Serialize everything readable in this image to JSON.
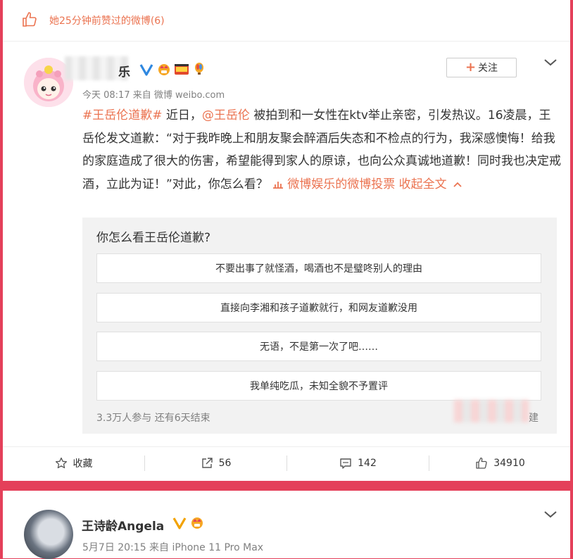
{
  "liked_bar": {
    "text": "她25分钟前赞过的微博(6)"
  },
  "post": {
    "nickname": "乐",
    "follow_label": "关注",
    "meta": "今天 08:17 来自 微博 weibo.com",
    "content": {
      "topic": "#王岳伦道歉#",
      "t1": " 近日，",
      "mention": "@王岳伦",
      "t2": " 被拍到和一女性在ktv举止亲密，引发热议。16凌晨，王岳伦发文道歉：“对于我昨晚上和朋友聚会醉酒后失态和不检点的行为，我深感懊悔！给我的家庭造成了很大的伤害，希望能得到家人的原谅，也向公众真诚地道歉！同时我也决定戒酒，立此为证！”对此，你怎么看？ ",
      "vote_link": "微博娱乐的微博投票",
      "collapse": "收起全文"
    },
    "poll": {
      "question": "你怎么看王岳伦道歉?",
      "options": [
        "不要出事了就怪酒，喝酒也不是璧咚别人的理由",
        "直接向李湘和孩子道歉就行，和网友道歉没用",
        "无语，不是第一次了吧……",
        "我单纯吃瓜，未知全貌不予置评"
      ],
      "footer": "3.3万人参与 还有6天结束",
      "footer_end": "建"
    },
    "actions": {
      "favorite": "收藏",
      "repost": "56",
      "comment": "142",
      "like": "34910"
    }
  },
  "post2": {
    "nickname": "王诗龄Angela",
    "meta": "5月7日 20:15 来自 iPhone 11 Pro Max"
  },
  "colors": {
    "accent": "#eb7350",
    "background": "#e4405a",
    "verified": "#2f88e0"
  }
}
